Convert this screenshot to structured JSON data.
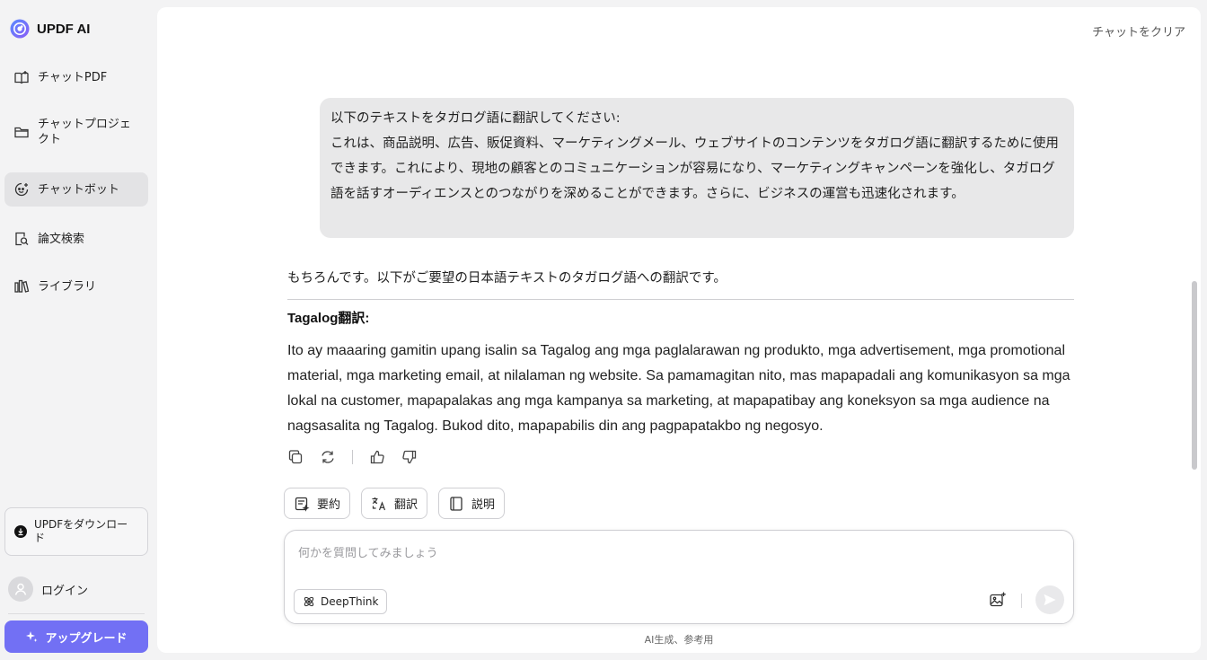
{
  "app": {
    "brand_name": "UPDF AI"
  },
  "sidebar": {
    "items": [
      {
        "label": "チャットPDF",
        "icon": "book-icon"
      },
      {
        "label": "チャットプロジェクト",
        "icon": "folder-icon"
      },
      {
        "label": "チャットボット",
        "icon": "bot-icon",
        "active": true
      },
      {
        "label": "論文検索",
        "icon": "document-search-icon"
      },
      {
        "label": "ライブラリ",
        "icon": "library-icon"
      }
    ],
    "download_label": "UPDFをダウンロード",
    "login_label": "ログイン",
    "upgrade_label": "アップグレード"
  },
  "header": {
    "clear_chat_label": "チャットをクリア"
  },
  "conversation": {
    "user_message_title": "以下のテキストをタガログ語に翻訳してください:",
    "user_message_body": "これは、商品説明、広告、販促資料、マーケティングメール、ウェブサイトのコンテンツをタガログ語に翻訳するために使用できます。これにより、現地の顧客とのコミュニケーションが容易になり、マーケティングキャンペーンを強化し、タガログ語を話すオーディエンスとのつながりを深めることができます。さらに、ビジネスの運営も迅速化されます。",
    "assistant_intro": "もちろんです。以下がご要望の日本語テキストのタガログ語への翻訳です。",
    "assistant_heading": "Tagalog翻訳:",
    "assistant_body": "Ito ay maaaring gamitin upang isalin sa Tagalog ang mga paglalarawan ng produkto, mga advertisement, mga promotional material, mga marketing email, at nilalaman ng website. Sa pamamagitan nito, mas mapapadali ang komunikasyon sa mga lokal na customer, mapapalakas ang mga kampanya sa marketing, at mapapatibay ang koneksyon sa mga audience na nagsasalita ng Tagalog. Bukod dito, mapapabilis din ang pagpapatakbo ng negosyo."
  },
  "quick_actions": {
    "summarize": "要約",
    "translate": "翻訳",
    "explain": "説明"
  },
  "composer": {
    "placeholder": "何かを質問してみましょう",
    "deepthink_label": "DeepThink"
  },
  "footer": {
    "note": "AI生成、参考用"
  },
  "colors": {
    "accent": "#7270f4",
    "sidebar_bg": "#f3f3f4",
    "bubble_bg": "#e8e8e9"
  }
}
